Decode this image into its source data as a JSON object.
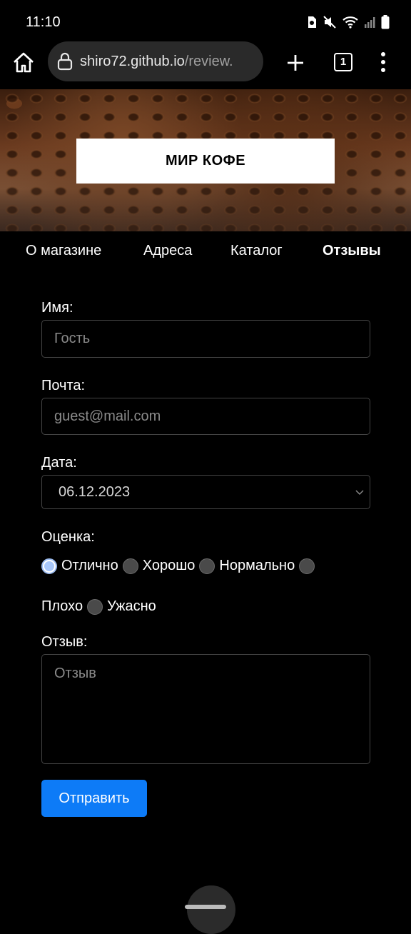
{
  "status_bar": {
    "time": "11:10"
  },
  "browser": {
    "url_domain": "shiro72.github.io",
    "url_path": "/review.",
    "tab_count": "1"
  },
  "hero": {
    "title": "МИР КОФЕ"
  },
  "nav": {
    "items": [
      {
        "label": "О магазине",
        "active": false
      },
      {
        "label": "Адреса",
        "active": false
      },
      {
        "label": "Каталог",
        "active": false
      },
      {
        "label": "Отзывы",
        "active": true
      }
    ]
  },
  "form": {
    "name_label": "Имя:",
    "name_placeholder": "Гость",
    "email_label": "Почта:",
    "email_placeholder": "guest@mail.com",
    "date_label": "Дата:",
    "date_value": "06.12.2023",
    "rating_label": "Оценка:",
    "rating_options": [
      {
        "label": "Отлично",
        "checked": true
      },
      {
        "label": "Хорошо",
        "checked": false
      },
      {
        "label": "Нормально",
        "checked": false
      },
      {
        "label": "Плохо",
        "checked": false
      },
      {
        "label": "Ужасно",
        "checked": false
      }
    ],
    "review_label": "Отзыв:",
    "review_placeholder": "Отзыв",
    "submit_label": "Отправить"
  },
  "colors": {
    "accent": "#0d7bf7",
    "radio_checked": "#a8c7fa"
  }
}
